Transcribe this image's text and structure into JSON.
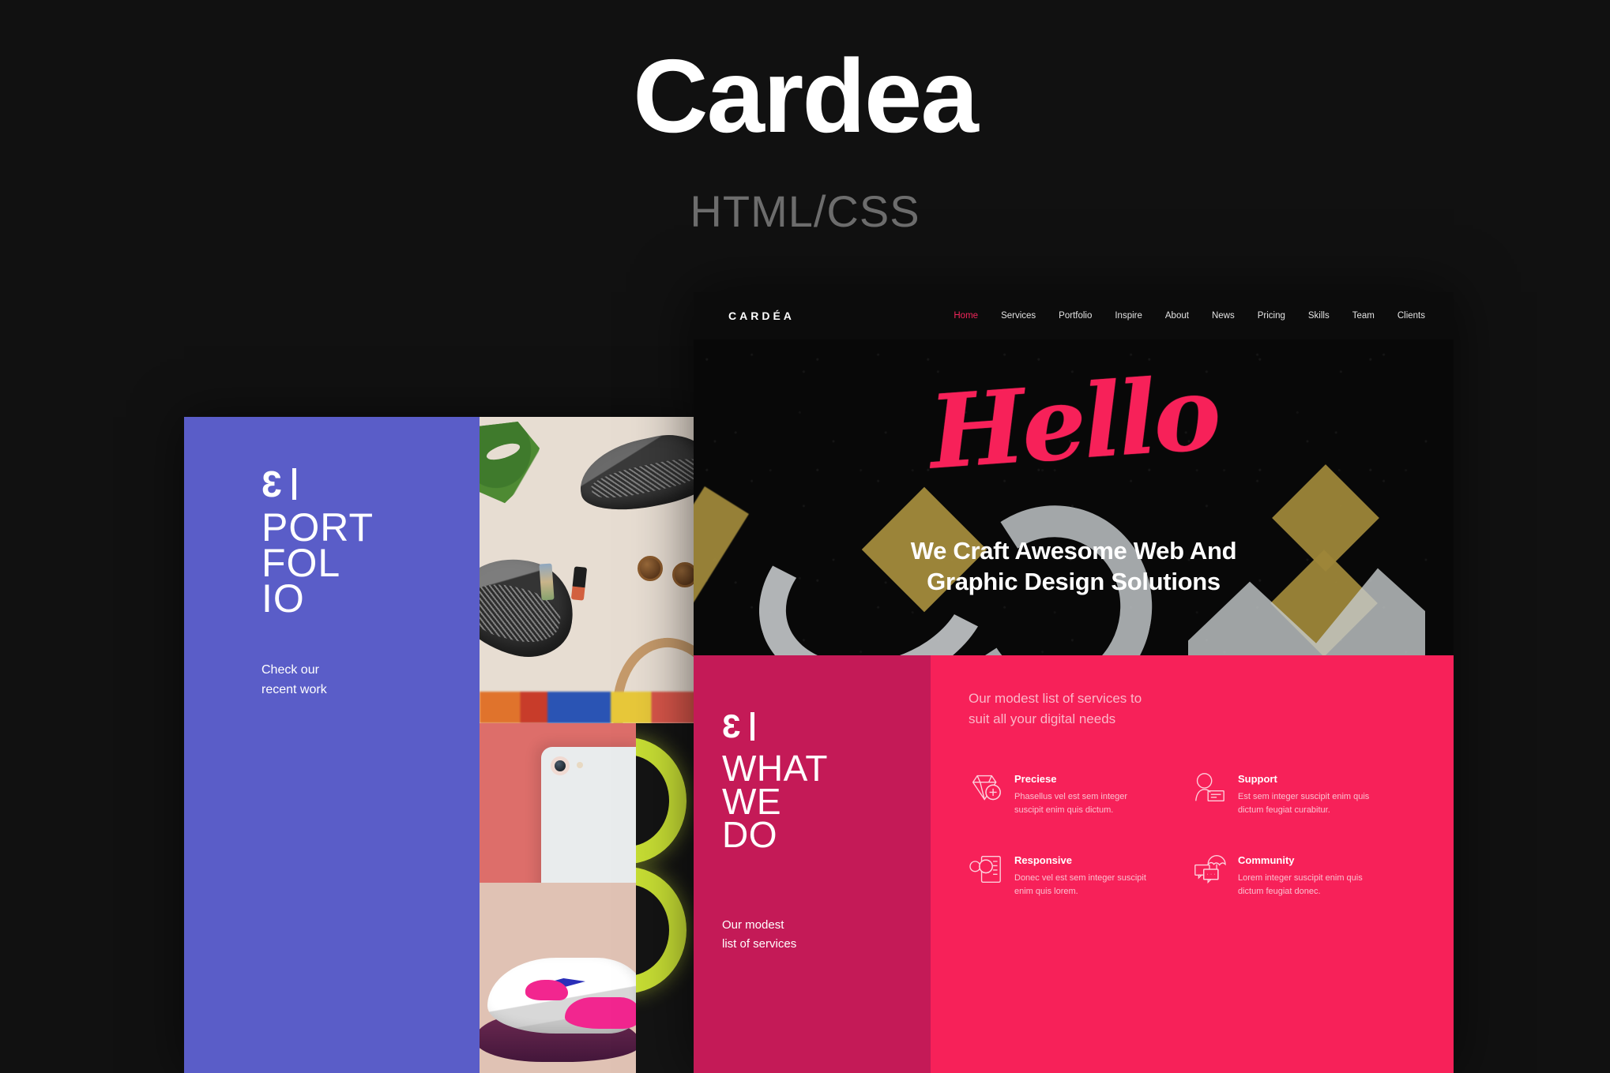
{
  "brand": {
    "title": "Cardea",
    "subtitle": "HTML/CSS"
  },
  "colors": {
    "page_background": "#111111",
    "accent_pink": "#f72159",
    "accent_pink_dark": "#c41a57",
    "accent_blue": "#5a5dc8",
    "gold": "#a38b3c",
    "nav_background": "#0c0c0c",
    "hero_background": "#080808",
    "subtitle_grey": "#6d6d6d"
  },
  "portfolio_mockup": {
    "logo_mark": "3",
    "title_lines": [
      "PORT",
      "FOL",
      "IO"
    ],
    "subtitle_lines": [
      "Check our",
      "recent work"
    ],
    "photos": [
      {
        "name": "flatlay-sneakers-accessories"
      },
      {
        "name": "white-phone-on-coral"
      },
      {
        "name": "pink-nike-sneaker"
      },
      {
        "name": "neon-green-lights"
      }
    ]
  },
  "site_mockup": {
    "logo": "CARDÉA",
    "nav": [
      {
        "label": "Home",
        "active": true
      },
      {
        "label": "Services",
        "active": false
      },
      {
        "label": "Portfolio",
        "active": false
      },
      {
        "label": "Inspire",
        "active": false
      },
      {
        "label": "About",
        "active": false
      },
      {
        "label": "News",
        "active": false
      },
      {
        "label": "Pricing",
        "active": false
      },
      {
        "label": "Skills",
        "active": false
      },
      {
        "label": "Team",
        "active": false
      },
      {
        "label": "Clients",
        "active": false
      }
    ],
    "hero": {
      "script_word": "Hello",
      "headline_lines": [
        "We Craft Awesome Web And",
        "Graphic Design Solutions"
      ]
    },
    "what_we_do": {
      "logo_mark": "3",
      "title_lines": [
        "WHAT",
        "WE",
        "DO"
      ],
      "subtitle_lines": [
        "Our modest",
        "list of services"
      ],
      "intro_lines": [
        "Our modest list of services to",
        "suit all your digital needs"
      ],
      "services": [
        {
          "icon": "diamond-plus-icon",
          "name": "Preciese",
          "desc": "Phasellus vel est sem integer suscipit enim quis dictum."
        },
        {
          "icon": "user-card-icon",
          "name": "Support",
          "desc": "Est sem integer suscipit enim quis dictum feugiat curabitur."
        },
        {
          "icon": "glasses-document-icon",
          "name": "Responsive",
          "desc": "Donec vel est sem integer suscipit enim quis lorem."
        },
        {
          "icon": "chat-umbrella-icon",
          "name": "Community",
          "desc": "Lorem integer suscipit enim quis dictum feugiat donec."
        }
      ]
    }
  }
}
